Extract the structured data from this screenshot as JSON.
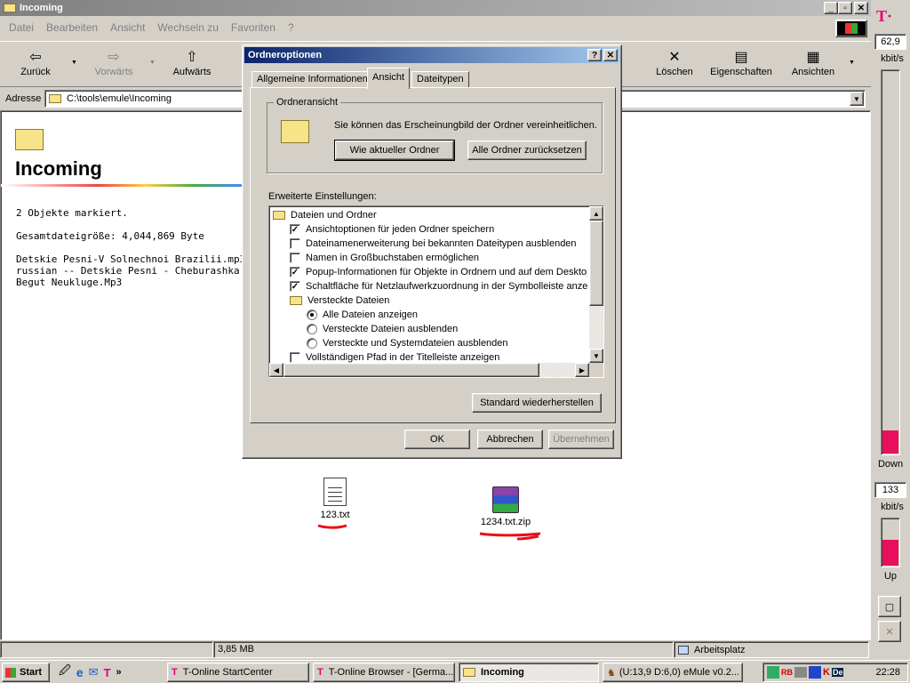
{
  "explorer": {
    "title": "Incoming",
    "menu": [
      "Datei",
      "Bearbeiten",
      "Ansicht",
      "Wechseln zu",
      "Favoriten",
      "?"
    ],
    "toolbar": {
      "back": "Zurück",
      "forward": "Vorwärts",
      "up": "Aufwärts",
      "delete": "Löschen",
      "properties": "Eigenschaften",
      "views": "Ansichten"
    },
    "address_label": "Adresse",
    "address_value": "C:\\tools\\emule\\Incoming",
    "folder_heading": "Incoming",
    "info": {
      "selected": "2 Objekte markiert.",
      "total_size": "Gesamtdateigröße: 4,044,869 Byte",
      "file_line1": "Detskie Pesni-V Solnechnoi Brazilii.mp3",
      "file_line2": "russian -- Detskie Pesni - Cheburashka - Pus",
      "file_line3": "Begut Neukluge.Mp3"
    },
    "files": [
      {
        "name": "123.txt",
        "icon": "text-file-icon"
      },
      {
        "name": "1234.txt.zip",
        "icon": "winrar-archive-icon"
      }
    ],
    "status": {
      "size": "3,85 MB",
      "zone": "Arbeitsplatz"
    }
  },
  "dialog": {
    "title": "Ordneroptionen",
    "tabs": [
      "Allgemeine Informationen",
      "Ansicht",
      "Dateitypen"
    ],
    "active_tab": "Ansicht",
    "group_title": "Ordneransicht",
    "group_text": "Sie können das Erscheinungbild der Ordner vereinheitlichen.",
    "btn_like_current": "Wie aktueller Ordner",
    "btn_reset_all": "Alle Ordner zurücksetzen",
    "advanced_label": "Erweiterte Einstellungen:",
    "tree": [
      {
        "type": "folder",
        "label": "Dateien und Ordner",
        "indent": 0
      },
      {
        "type": "check",
        "checked": true,
        "label": "Ansichtoptionen für jeden Ordner speichern",
        "indent": 1
      },
      {
        "type": "check",
        "checked": false,
        "label": "Dateinamenerweiterung bei bekannten Dateitypen ausblenden",
        "indent": 1
      },
      {
        "type": "check",
        "checked": false,
        "label": "Namen in Großbuchstaben ermöglichen",
        "indent": 1
      },
      {
        "type": "check",
        "checked": true,
        "label": "Popup-Informationen für Objekte in Ordnern und auf dem Desktop a",
        "indent": 1
      },
      {
        "type": "check",
        "checked": true,
        "label": "Schaltfläche für Netzlaufwerkzuordnung in der Symbolleiste anzeige",
        "indent": 1
      },
      {
        "type": "folder",
        "label": "Versteckte Dateien",
        "indent": 1
      },
      {
        "type": "radio",
        "checked": true,
        "label": "Alle Dateien anzeigen",
        "indent": 2
      },
      {
        "type": "radio",
        "checked": false,
        "label": "Versteckte Dateien ausblenden",
        "indent": 2
      },
      {
        "type": "radio",
        "checked": false,
        "label": "Versteckte und Systemdateien ausblenden",
        "indent": 2
      },
      {
        "type": "check",
        "checked": false,
        "label": "Vollständigen Pfad in der Titelleiste anzeigen",
        "indent": 1
      }
    ],
    "btn_restore": "Standard wiederherstellen",
    "btn_ok": "OK",
    "btn_cancel": "Abbrechen",
    "btn_apply": "Übernehmen"
  },
  "meter": {
    "down_value": "62,9",
    "down_unit": "kbit/s",
    "down_label": "Down",
    "down_level": 0.06,
    "up_value": "133",
    "up_unit": "kbit/s",
    "up_label": "Up",
    "up_level": 0.55
  },
  "taskbar": {
    "start": "Start",
    "tasks": [
      "T-Online StartCenter",
      "T-Online Browser - [Germa...",
      "Incoming",
      "(U:13,9 D:6,0) eMule v0.2..."
    ],
    "clock": "22:28"
  },
  "colors": {
    "title_active": "#0a246a",
    "annotation_red": "#e8101a",
    "meter_fill": "#e8105c",
    "brand_magenta": "#e20074"
  }
}
